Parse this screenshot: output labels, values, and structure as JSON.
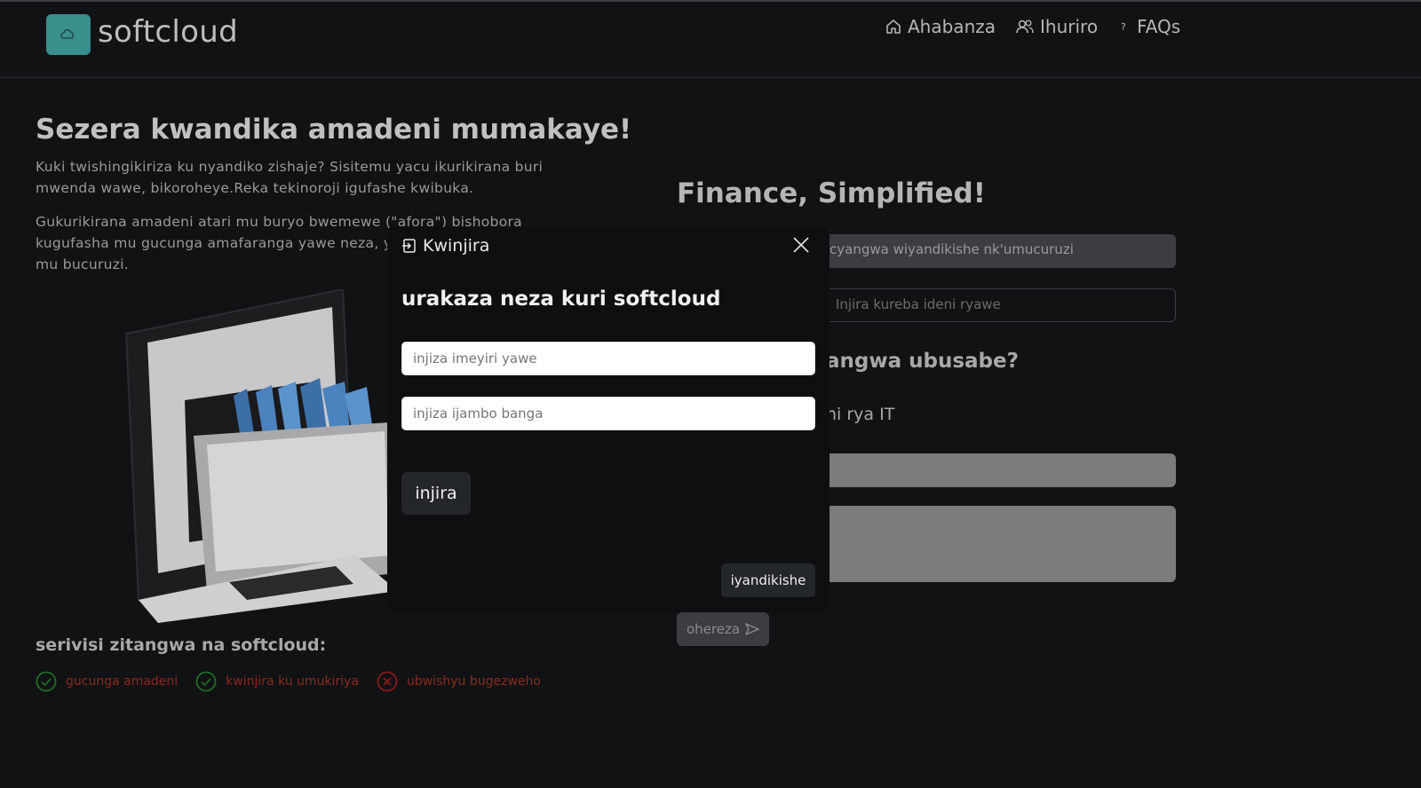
{
  "header": {
    "brand": "softcloud",
    "nav": [
      {
        "label": "Ahabanza",
        "icon": "home-icon"
      },
      {
        "label": "Ihuriro",
        "icon": "users-icon"
      },
      {
        "label": "FAQs",
        "icon": "question-icon"
      }
    ]
  },
  "hero": {
    "title": "Sezera kwandika amadeni mumakaye!",
    "p1": "Kuki twishingikiriza ku nyandiko zishaje? Sisitemu yacu ikurikirana buri mwenda wawe, bikoroheye.Reka tekinoroji igufashe kwibuka.",
    "p2": "Gukurikirana amadeni atari mu buryo bwemewe (\"afora\") bishobora kugufasha mu gucunga amafaranga yawe neza, yaba ayawe bwite cyangwa mu bucuruzi."
  },
  "services": {
    "title": "serivisi zitangwa na softcloud:",
    "items": [
      {
        "label": "gucunga amadeni",
        "status": "check",
        "color": "#1f7a2e"
      },
      {
        "label": "kwinjira ku umukiriya",
        "status": "check",
        "color": "#1f7a2e"
      },
      {
        "label": "ubwishyu bugezweho",
        "status": "cross",
        "color": "#8a1a1a"
      }
    ]
  },
  "right": {
    "title": "Finance, Simplified!",
    "input1_text": "cyangwa wiyandikishe nk'umucuruzi",
    "input2_placeholder": "Injira kureba ideni ryawe",
    "heading": "angwa ubusabe?",
    "sub": "ni rya IT",
    "send_label": "ohereza"
  },
  "modal": {
    "title": "Kwinjira",
    "heading": "urakaza neza kuri softcloud",
    "email_placeholder": "injiza imeyiri yawe",
    "password_placeholder": "injiza ijambo banga",
    "login_label": "injira",
    "register_label": "iyandikishe"
  }
}
